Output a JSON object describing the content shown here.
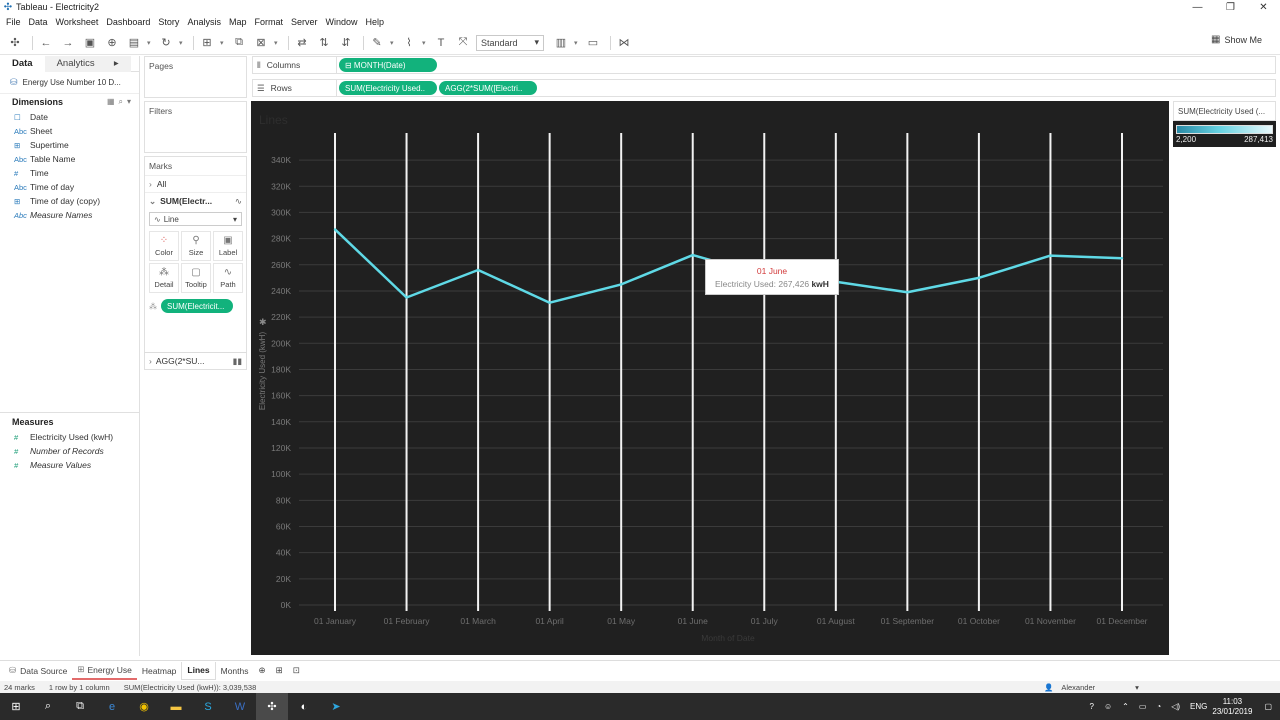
{
  "window": {
    "title": "Tableau - Electricity2",
    "min": "—",
    "max": "❐",
    "close": "✕"
  },
  "menu": [
    "File",
    "Data",
    "Worksheet",
    "Dashboard",
    "Story",
    "Analysis",
    "Map",
    "Format",
    "Server",
    "Window",
    "Help"
  ],
  "toolbar": {
    "mark_size_select": "Standard",
    "show_me": "Show Me"
  },
  "data_pane": {
    "tab_data": "Data",
    "tab_analytics": "Analytics",
    "datasource": "Energy Use Number 10 D...",
    "dimensions_title": "Dimensions",
    "dimensions": [
      {
        "icon": "☐",
        "label": "Date"
      },
      {
        "icon": "Abc",
        "label": "Sheet"
      },
      {
        "icon": "⊞",
        "label": "Supertime"
      },
      {
        "icon": "Abc",
        "label": "Table Name"
      },
      {
        "icon": "#",
        "label": "Time"
      },
      {
        "icon": "Abc",
        "label": "Time of day"
      },
      {
        "icon": "⊞",
        "label": "Time of day (copy)"
      },
      {
        "icon": "Abc",
        "label": "Measure Names"
      }
    ],
    "measures_title": "Measures",
    "measures": [
      {
        "icon": "#",
        "label": "Electricity Used (kwH)"
      },
      {
        "icon": "#",
        "label": "Number of Records"
      },
      {
        "icon": "#",
        "label": "Measure Values"
      }
    ]
  },
  "cards": {
    "pages": "Pages",
    "filters": "Filters",
    "marks": "Marks",
    "marks_all": "All",
    "marks_sum": "SUM(Electr...",
    "mark_type": "Line",
    "buttons": [
      "Color",
      "Size",
      "Label",
      "Detail",
      "Tooltip",
      "Path"
    ],
    "marks_pill": "SUM(Electricit...",
    "marks_agg": "AGG(2*SU..."
  },
  "shelves": {
    "columns_label": "Columns",
    "rows_label": "Rows",
    "columns_pill": "⊟ MONTH(Date)",
    "rows_pill_1": "SUM(Electricity Used..",
    "rows_pill_2": "AGG(2*SUM([Electri.."
  },
  "viz": {
    "title": "Lines"
  },
  "chart_data": {
    "type": "line",
    "title": "Lines",
    "xlabel": "Month of Date",
    "ylabel": "Electricity Used (kwH)",
    "categories": [
      "01 January",
      "01 February",
      "01 March",
      "01 April",
      "01 May",
      "01 June",
      "01 July",
      "01 August",
      "01 September",
      "01 October",
      "01 November",
      "01 December"
    ],
    "series": [
      {
        "values": [
          287000,
          235000,
          256000,
          231000,
          245000,
          267426,
          252000,
          247000,
          239000,
          250000,
          267000,
          265000
        ]
      }
    ],
    "ylim": [
      0,
      350000
    ],
    "yticks": [
      "0K",
      "20K",
      "40K",
      "60K",
      "80K",
      "100K",
      "120K",
      "140K",
      "160K",
      "180K",
      "200K",
      "220K",
      "240K",
      "260K",
      "280K",
      "300K",
      "320K",
      "340K"
    ],
    "line_color": "#5fd9e6",
    "background": "#202020"
  },
  "tooltip": {
    "date": "01 June",
    "label": "Electricity Used: 267,426",
    "unit": "kwH"
  },
  "legend": {
    "title": "SUM(Electricity Used (...",
    "min": "2,200",
    "max": "287,413"
  },
  "sheet_tabs": {
    "datasource": "Data Source",
    "tabs": [
      "Energy Use",
      "Heatmap",
      "Lines",
      "Months"
    ]
  },
  "status": {
    "marks": "24 marks",
    "rows": "1 row by 1 column",
    "sum": "SUM(Electricity Used (kwH)): 3,039,538",
    "user": "Alexander"
  },
  "taskbar": {
    "lang": "ENG",
    "time": "11:03",
    "date": "23/01/2019"
  }
}
